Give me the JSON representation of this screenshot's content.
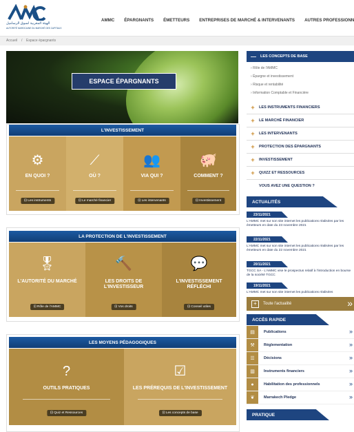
{
  "header": {
    "logo_arabic": "الهيئة المغربية لسوق الرساميل",
    "logo_french": "AUTORITÉ MAROCAINE DU MARCHÉ DES CAPITAUX",
    "nav": [
      "AMMC",
      "ÉPARGNANTS",
      "ÉMETTEURS",
      "ENTREPRISES DE MARCHÉ & INTERVENANTS",
      "AUTRES PROFESSIONNELS"
    ]
  },
  "breadcrumb": {
    "home": "Accueil",
    "sep": "/",
    "current": "Espace épargnants"
  },
  "hero": {
    "title": "ESPACE ÉPARGNANTS"
  },
  "investissement": {
    "title": "L'INVESTISSEMENT",
    "tiles": [
      {
        "icon": "gears-icon",
        "glyph": "⚙",
        "label": "EN QUOI ?",
        "link": "⊡ Les instruments"
      },
      {
        "icon": "chart-line-icon",
        "glyph": "⟋",
        "label": "OÙ ?",
        "link": "⊡ Le marché financier"
      },
      {
        "icon": "people-icon",
        "glyph": "👥",
        "label": "VIA QUI ?",
        "link": "⊡ Les intervenants"
      },
      {
        "icon": "piggy-bank-icon",
        "glyph": "🐖",
        "label": "COMMENT ?",
        "link": "⊡ Investissement"
      }
    ]
  },
  "protection": {
    "title": "LA PROTECTION DE L'INVESTISSEMENT",
    "tiles": [
      {
        "icon": "award-ribbon-icon",
        "glyph": "🎖",
        "label": "L'AUTORITÉ DU MARCHÉ",
        "link": "⊡ Rôle de l'AMMC"
      },
      {
        "icon": "gavel-icon",
        "glyph": "🔨",
        "label": "LES DROITS DE L'INVESTISSEUR",
        "link": "⊡ Vos droits"
      },
      {
        "icon": "chat-bubbles-icon",
        "glyph": "💬",
        "label": "L'INVESTISSEMENT RÉFLÉCHI",
        "link": "⊡ Conseil utiles"
      }
    ]
  },
  "moyens": {
    "title": "LES MOYENS PÉDAGOGIQUES",
    "tiles": [
      {
        "icon": "question-icon",
        "glyph": "?",
        "label": "OUTILS PRATIQUES",
        "link": "⊡ Quiz et Ressources"
      },
      {
        "icon": "checkbox-icon",
        "glyph": "☑",
        "label": "LES PRÉREQUIS DE L'INVESTISSEMENT",
        "link": "⊡ Les concepts de base"
      }
    ]
  },
  "sidebar": {
    "concepts": {
      "title": "LES CONCEPTS DE BASE",
      "items": [
        "Rôle de l'AMMC",
        "Épargne et investissement",
        "Risque et rentabilité",
        "Information Comptable et Financière"
      ]
    },
    "accordion": [
      "LES INSTRUMENTS FINANCIERS",
      "LE MARCHÉ FINANCIER",
      "LES INTERVENANTS",
      "PROTECTION DES ÉPARGNANTS",
      "INVESTISSEMENT",
      "QUIZZ ET RESSOURCES"
    ],
    "question": "VOUS AVEZ UNE QUESTION ?",
    "news": {
      "title": "ACTUALITÉS",
      "items": [
        {
          "date": "23/11/2021",
          "text": "L'AMMC met sur son site internet les publications réalisées par les émetteurs en date du 23 novembre 2021"
        },
        {
          "date": "22/11/2021",
          "text": "L'AMMC met sur son site internet les publications réalisées par les émetteurs en date du 22 novembre 2021"
        },
        {
          "date": "20/11/2021",
          "text": "TGCC SA - L'AMMC vise le prospectus relatif à l'introduction en bourse de la société TGCC"
        },
        {
          "date": "19/11/2021",
          "text": "L'AMMC met sur son site internet les publications réalisées"
        }
      ],
      "all": "Toute l'actualité"
    },
    "quick": {
      "title": "ACCÈS RAPIDE",
      "items": [
        {
          "label": "Publications",
          "icon": "document-icon",
          "glyph": "▤"
        },
        {
          "label": "Réglementation",
          "icon": "gavel-icon",
          "glyph": "⚒"
        },
        {
          "label": "Décisions",
          "icon": "list-icon",
          "glyph": "☰"
        },
        {
          "label": "Instruments financiers",
          "icon": "bar-chart-icon",
          "glyph": "▥"
        },
        {
          "label": "Habilitation des professionnels",
          "icon": "badge-icon",
          "glyph": "●"
        },
        {
          "label": "Marrakech Pledge",
          "icon": "leaf-icon",
          "glyph": "❦"
        }
      ]
    },
    "pratique": {
      "title": "PRATIQUE"
    }
  }
}
